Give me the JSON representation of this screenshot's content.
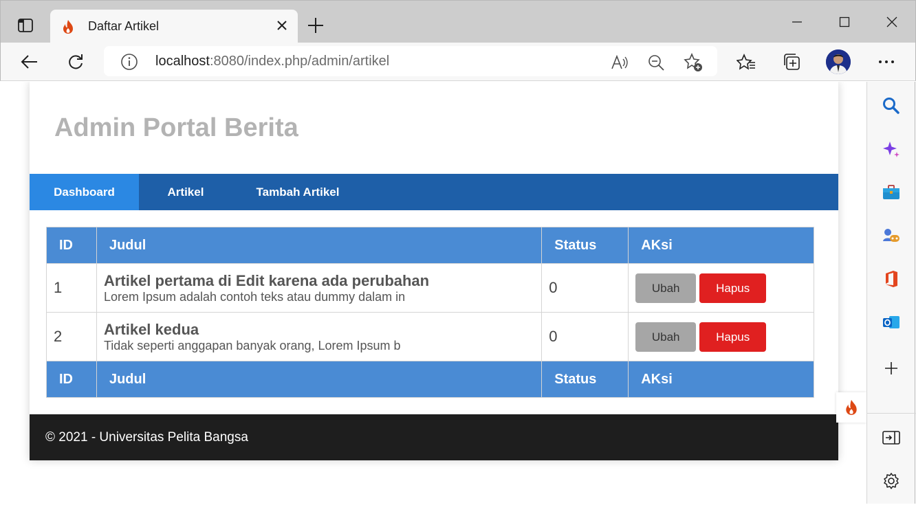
{
  "browser": {
    "tab_title": "Daftar Artikel",
    "url_host": "localhost",
    "url_rest": ":8080/index.php/admin/artikel"
  },
  "page": {
    "site_title": "Admin Portal Berita",
    "nav": [
      "Dashboard",
      "Artikel",
      "Tambah Artikel"
    ],
    "table_headers": [
      "ID",
      "Judul",
      "Status",
      "AKsi"
    ],
    "rows": [
      {
        "id": "1",
        "title": "Artikel pertama di Edit karena ada perubahan",
        "desc": "Lorem Ipsum adalah contoh teks atau dummy dalam in",
        "status": "0"
      },
      {
        "id": "2",
        "title": "Artikel kedua",
        "desc": "Tidak seperti anggapan banyak orang, Lorem Ipsum b",
        "status": "0"
      }
    ],
    "btn_edit": "Ubah",
    "btn_delete": "Hapus",
    "footer": "© 2021 - Universitas Pelita Bangsa"
  },
  "colors": {
    "nav_bg": "#1e5fa8",
    "nav_active": "#2b88e3",
    "table_header": "#4a8bd4",
    "delete_button": "#e02020",
    "edit_button": "#a6a6a6",
    "footer_bg": "#1e1e1e"
  }
}
